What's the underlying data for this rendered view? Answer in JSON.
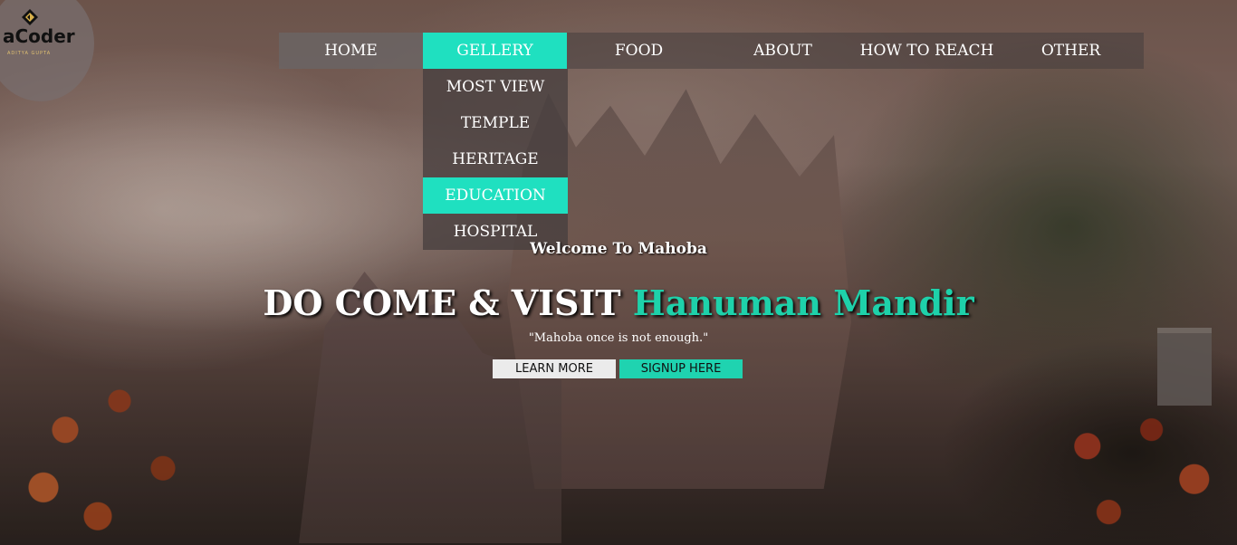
{
  "brand": {
    "logo_text": "aCoder",
    "logo_subtext": "ADITYA GUPTA",
    "accent_color": "#1fe0c0"
  },
  "nav": {
    "items": [
      {
        "label": "HOME",
        "icon": ""
      },
      {
        "label": "GELLERY",
        "active": true
      },
      {
        "label": "FOOD"
      },
      {
        "label": "ABOUT"
      },
      {
        "label": "HOW TO REACH"
      },
      {
        "label": "OTHER"
      }
    ]
  },
  "dropdown": {
    "items": [
      {
        "label": "MOST VIEW"
      },
      {
        "label": "TEMPLE"
      },
      {
        "label": "HERITAGE"
      },
      {
        "label": "EDUCATION",
        "active": true
      },
      {
        "label": "HOSPITAL"
      }
    ]
  },
  "hero": {
    "welcome": "Welcome To Mahoba",
    "headline_main": "DO COME & VISIT",
    "headline_accent": "Hanuman Mandir",
    "quote": "\"Mahoba once is not enough.\"",
    "learn_more": "LEARN MORE",
    "signup": "SIGNUP HERE"
  }
}
